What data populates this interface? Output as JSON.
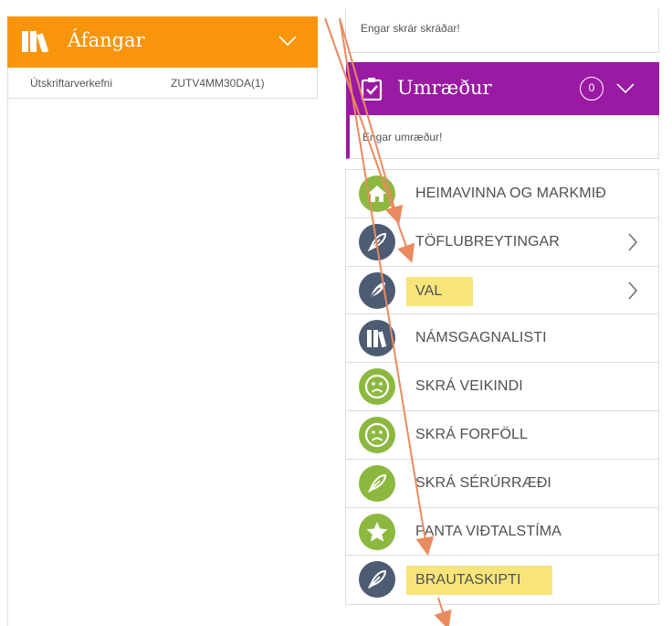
{
  "afangar": {
    "title": "Áfangar",
    "row": {
      "name": "Útskriftarverkefni",
      "code": "ZUTV4MM30DA(1)"
    }
  },
  "files": {
    "empty_text": "Engar skrár skráðar!"
  },
  "umraedur": {
    "title": "Umræður",
    "count": "0",
    "empty_text": "Engar umræður!"
  },
  "menu": {
    "items": [
      {
        "label": "HEIMAVINNA OG MARKMIÐ",
        "icon": "home-icon",
        "color": "#8db83f"
      },
      {
        "label": "TÖFLUBREYTINGAR",
        "icon": "pen-icon",
        "color": "#4d5b73"
      },
      {
        "label": "VAL",
        "icon": "pen-icon",
        "color": "#4d5b73",
        "highlighted": true
      },
      {
        "label": "NÁMSGAGNALISTI",
        "icon": "books-icon",
        "color": "#4d5b73"
      },
      {
        "label": "SKRÁ VEIKINDI",
        "icon": "sad-face-icon",
        "color": "#8db83f"
      },
      {
        "label": "SKRÁ FORFÖLL",
        "icon": "sad-face-icon",
        "color": "#8db83f"
      },
      {
        "label": "SKRÁ SÉRÚRRÆÐI",
        "icon": "pen-icon",
        "color": "#8db83f"
      },
      {
        "label": "PANTA VIÐTALSTÍMA",
        "icon": "star-icon",
        "color": "#8db83f"
      },
      {
        "label": "BRAUTASKIPTI",
        "icon": "pen-icon",
        "color": "#4d5b73",
        "highlighted": true
      }
    ]
  },
  "colors": {
    "orange": "#f9950b",
    "purple": "#9b1aa3",
    "highlight": "#f7e57a",
    "arrow": "#e98a5f"
  }
}
